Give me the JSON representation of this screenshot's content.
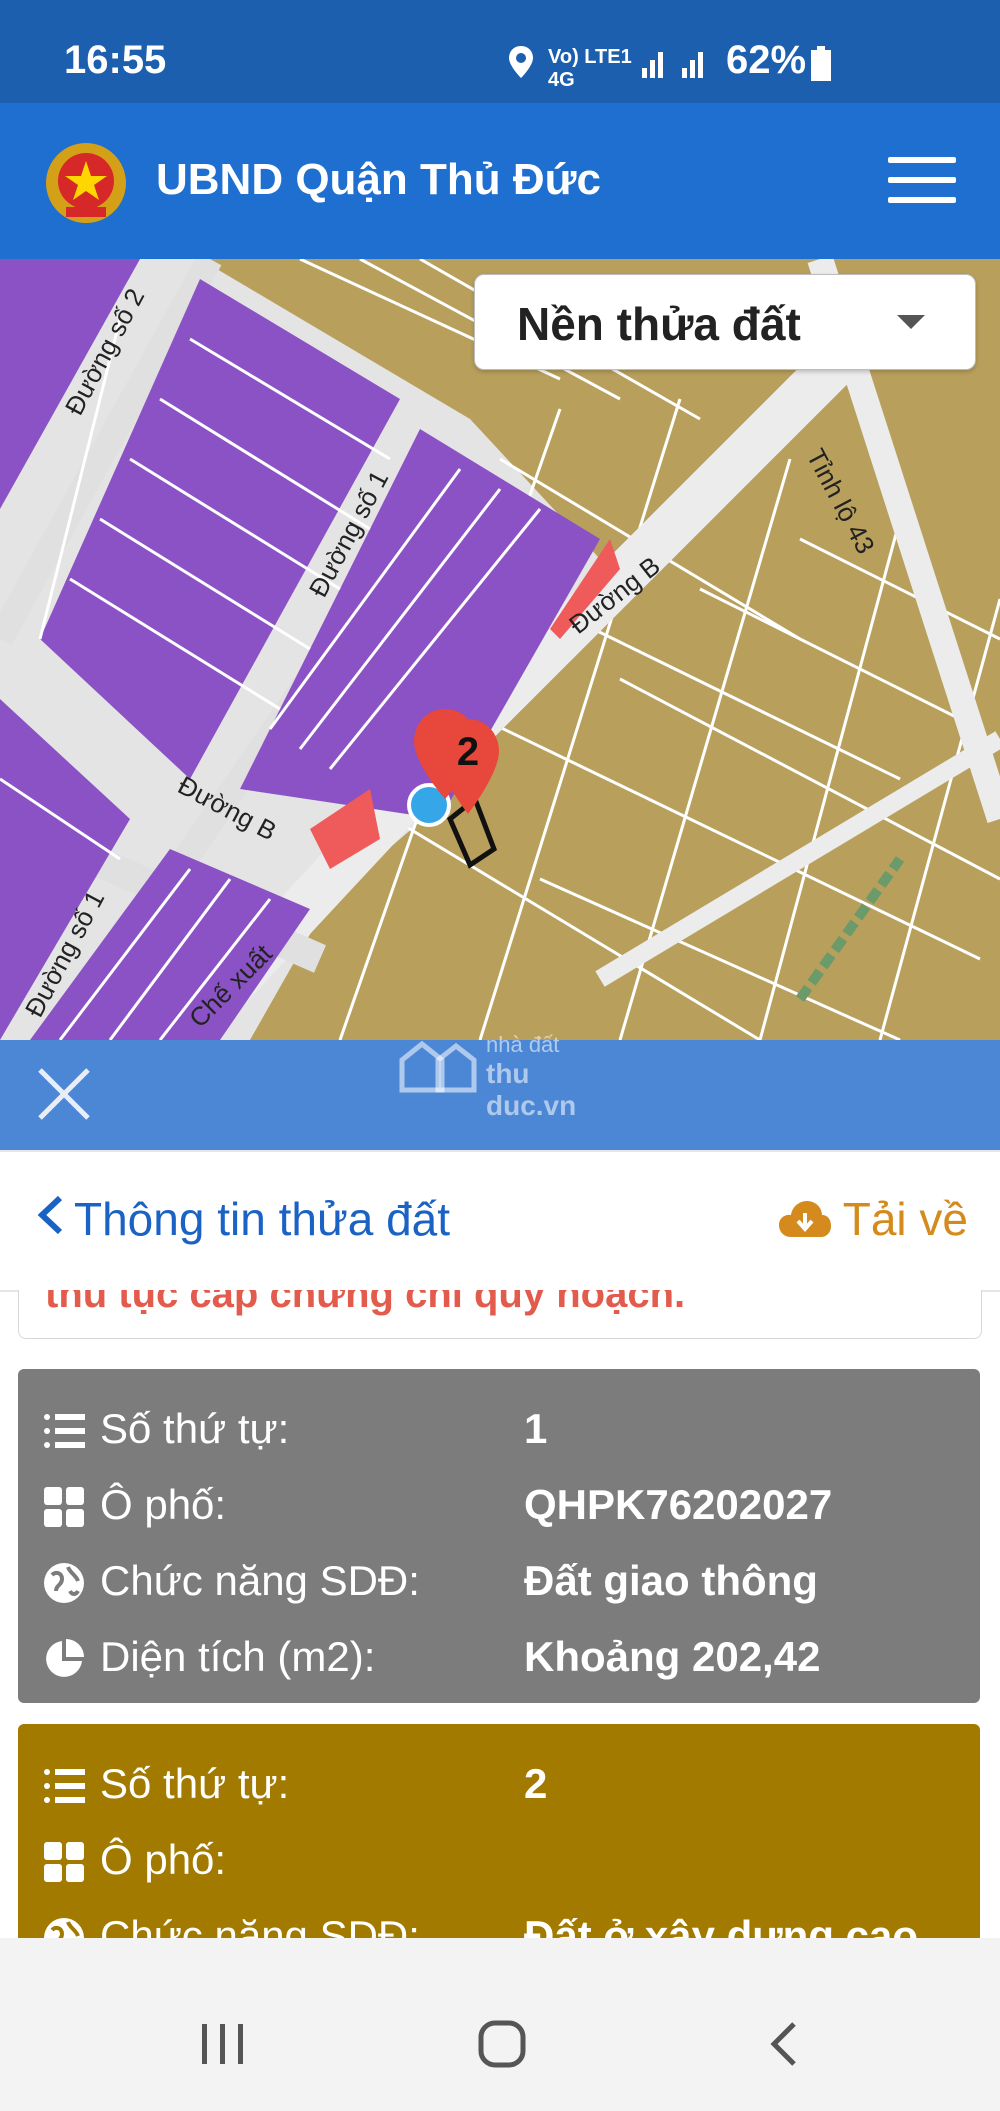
{
  "status": {
    "time": "16:55",
    "network": "Vo) LTE1 4G",
    "battery": "62%"
  },
  "header": {
    "title": "UBND Quận Thủ Đức"
  },
  "map": {
    "layer_select": "Nền thửa đất",
    "street_labels": [
      "Đường số 2",
      "Đường số 1",
      "Đường B",
      "Đường B",
      "Tỉnh lộ 43",
      "Đường số 1",
      "Chế xuất"
    ],
    "marker_label": "2",
    "watermark_top": "nhà đất",
    "watermark_bottom": "thu duc.vn"
  },
  "info": {
    "back_label": "Thông tin thửa đất",
    "download_label": "Tải về",
    "notice_text": "thủ tục cấp chứng chỉ quy hoạch."
  },
  "cards": [
    {
      "color": "#7c7c7c",
      "rows": [
        {
          "label": "Số thứ tự:",
          "value": "1",
          "icon": "list-icon"
        },
        {
          "label": "Ô phố:",
          "value": "QHPK76202027",
          "icon": "grid-icon"
        },
        {
          "label": "Chức năng SDĐ:",
          "value": "Đất giao thông",
          "icon": "globe-icon"
        },
        {
          "label": "Diện tích (m2):",
          "value": "Khoảng 202,42",
          "icon": "pie-chart-icon"
        }
      ]
    },
    {
      "color": "#a37a00",
      "rows": [
        {
          "label": "Số thứ tự:",
          "value": "2",
          "icon": "list-icon"
        },
        {
          "label": "Ô phố:",
          "value": "",
          "icon": "grid-icon"
        },
        {
          "label": "Chức năng SDĐ:",
          "value": "Đất ở xây dựng cao",
          "icon": "globe-icon"
        }
      ]
    }
  ],
  "colors": {
    "statusbar": "#1b5fae",
    "appbar": "#1e6fd0",
    "closebar": "#4c87d6",
    "parcel_purple": "#8a52c4",
    "parcel_tan": "#b8a05c",
    "parcel_red": "#ef5a5a",
    "marker": "#e8473b"
  }
}
